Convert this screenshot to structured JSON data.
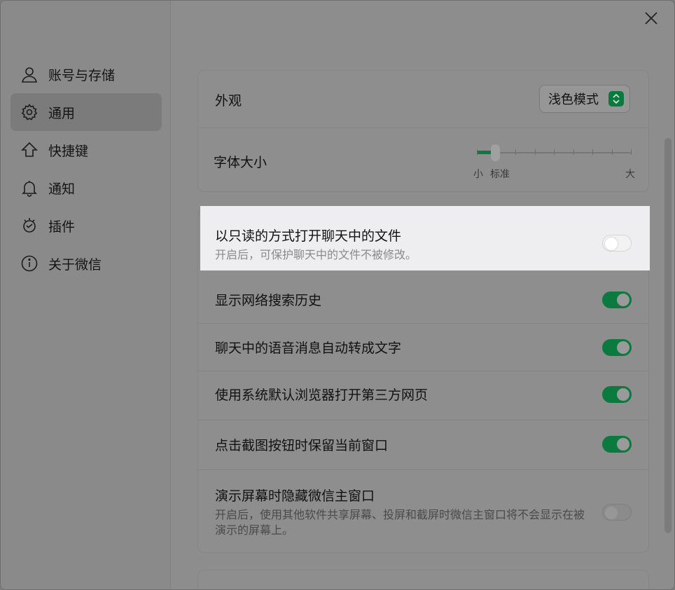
{
  "nav": {
    "items": [
      {
        "label": "账号与存储",
        "icon": "user-icon"
      },
      {
        "label": "通用",
        "icon": "gear-icon",
        "active": true
      },
      {
        "label": "快捷键",
        "icon": "shortcut-arrow-icon"
      },
      {
        "label": "通知",
        "icon": "bell-icon"
      },
      {
        "label": "插件",
        "icon": "plugin-icon"
      },
      {
        "label": "关于微信",
        "icon": "info-icon"
      }
    ]
  },
  "appearance": {
    "label": "外观",
    "value": "浅色模式"
  },
  "font_size": {
    "label": "字体大小",
    "small": "小",
    "standard": "标准",
    "large": "大",
    "level": 1,
    "steps": 9
  },
  "settings": [
    {
      "title": "以只读的方式打开聊天中的文件",
      "subtitle": "开启后，可保护聊天中的文件不被修改。",
      "on": false
    },
    {
      "title": "显示网络搜索历史",
      "on": true
    },
    {
      "title": "聊天中的语音消息自动转成文字",
      "on": true
    },
    {
      "title": "使用系统默认浏览器打开第三方网页",
      "on": true
    },
    {
      "title": "点击截图按钮时保留当前窗口",
      "on": true
    },
    {
      "title": "演示屏幕时隐藏微信主窗口",
      "subtitle": "开启后，使用其他软件共享屏幕、投屏和截屏时微信主窗口将不会显示在被演示的屏幕上。",
      "on": false
    }
  ],
  "colors": {
    "accent": "#0b7a3e",
    "highlight_bg": "#eeeef0"
  }
}
